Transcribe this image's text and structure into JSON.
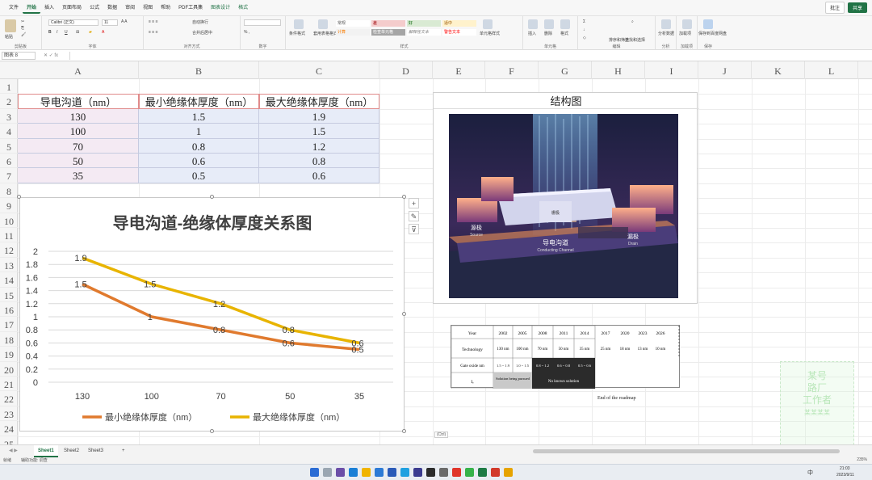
{
  "menu": {
    "items": [
      "文件",
      "开始",
      "插入",
      "页面布局",
      "公式",
      "数据",
      "审阅",
      "视图",
      "帮助",
      "PDF工具集",
      "图表设计",
      "格式"
    ],
    "active_index": 1,
    "right": {
      "comments": "批注",
      "share": "共享"
    }
  },
  "ribbon": {
    "groups": [
      "剪贴板",
      "字体",
      "对齐方式",
      "数字",
      "样式",
      "单元格",
      "编辑",
      "分析",
      "加载项",
      "保存"
    ],
    "font_name": "Calibri (正文)",
    "styles": [
      "常规",
      "差",
      "好",
      "适中",
      "计算",
      "检查单元格",
      "解释性文本",
      "警告文本"
    ],
    "buttons": [
      "粘贴",
      "插入",
      "删除",
      "格式",
      "自动换行",
      "合并后居中",
      "条件格式",
      "套用表格格式",
      "单元格样式",
      "排序和筛选",
      "查找和选择",
      "分析数据",
      "加载项",
      "保存到百度网盘"
    ]
  },
  "formula_bar": {
    "name_box": "图表 8",
    "fx": "fx"
  },
  "columns": [
    "A",
    "B",
    "C",
    "D",
    "E",
    "F",
    "G",
    "H",
    "I",
    "J",
    "K",
    "L"
  ],
  "rows": [
    "1",
    "2",
    "3",
    "4",
    "5",
    "6",
    "7",
    "8",
    "9",
    "10",
    "11",
    "12",
    "13",
    "14",
    "15",
    "16",
    "17",
    "18",
    "19",
    "20",
    "21",
    "22",
    "23",
    "24",
    "25"
  ],
  "table": {
    "headers": [
      "导电沟道（nm）",
      "最小绝缘体厚度（nm）",
      "最大绝缘体厚度（nm）"
    ],
    "rows": [
      [
        "130",
        "1.5",
        "1.9"
      ],
      [
        "100",
        "1",
        "1.5"
      ],
      [
        "70",
        "0.8",
        "1.2"
      ],
      [
        "50",
        "0.6",
        "0.8"
      ],
      [
        "35",
        "0.5",
        "0.6"
      ]
    ]
  },
  "chart_data": {
    "type": "line",
    "title": "导电沟道-绝缘体厚度关系图",
    "categories": [
      "130",
      "100",
      "70",
      "50",
      "35"
    ],
    "series": [
      {
        "name": "最小绝缘体厚度（nm）",
        "values": [
          1.5,
          1,
          0.8,
          0.6,
          0.5
        ],
        "color": "#e07a2e"
      },
      {
        "name": "最大绝缘体厚度（nm）",
        "values": [
          1.9,
          1.5,
          1.2,
          0.8,
          0.6
        ],
        "color": "#e8b400"
      }
    ],
    "ylim": [
      0,
      2
    ],
    "yticks": [
      "0",
      "0.2",
      "0.4",
      "0.6",
      "0.8",
      "1",
      "1.2",
      "1.4",
      "1.6",
      "1.8",
      "2"
    ],
    "grid": true,
    "legend": "bottom",
    "data_labels": true
  },
  "chart_side_buttons": [
    "+",
    "✎",
    "⊽"
  ],
  "structure": {
    "title": "结构图",
    "labels": {
      "source_cn": "源极",
      "source_en": "Source",
      "drain_cn": "漏极",
      "drain_en": "Drain",
      "channel_cn": "导电沟道",
      "channel_en": "Conducting Channel",
      "gate_cn": "栅极"
    }
  },
  "roadmap": {
    "header": [
      "Year",
      "2002",
      "2005",
      "2008",
      "2011",
      "2014",
      "2017",
      "2020",
      "2023",
      "2026"
    ],
    "technology": {
      "label": "Technology",
      "values": [
        "130 nm",
        "100 nm",
        "70 nm",
        "50 nm",
        "35 nm",
        "25 nm",
        "18 nm",
        "13 nm",
        "10 nm"
      ]
    },
    "gate_oxide": {
      "label": "Gate oxide nm",
      "values": [
        "1.5 ~ 1.9",
        "1.0 ~ 1.5",
        "0.8 ~ 1.2",
        "0.6 ~ 0.8",
        "0.5 ~ 0.6"
      ]
    },
    "leakage": {
      "label": "Iₑ"
    },
    "solution_pursued": "Solution being pursued",
    "no_solution": "No known solution",
    "end_note": "End of the roadmap"
  },
  "paste_options": "(Ctrl)",
  "sheets": {
    "tabs": [
      "Sheet1",
      "Sheet2",
      "Sheet3"
    ],
    "active": "Sheet1",
    "add": "+"
  },
  "status": {
    "left": "就绪",
    "accessibility": "辅助功能: 调查",
    "zoom": "235%"
  },
  "taskbar": {
    "time": "21:03",
    "date": "2023/9/11",
    "lang": "中"
  },
  "watermark": [
    "某号",
    "路厂",
    "工作者",
    "某某某某"
  ]
}
